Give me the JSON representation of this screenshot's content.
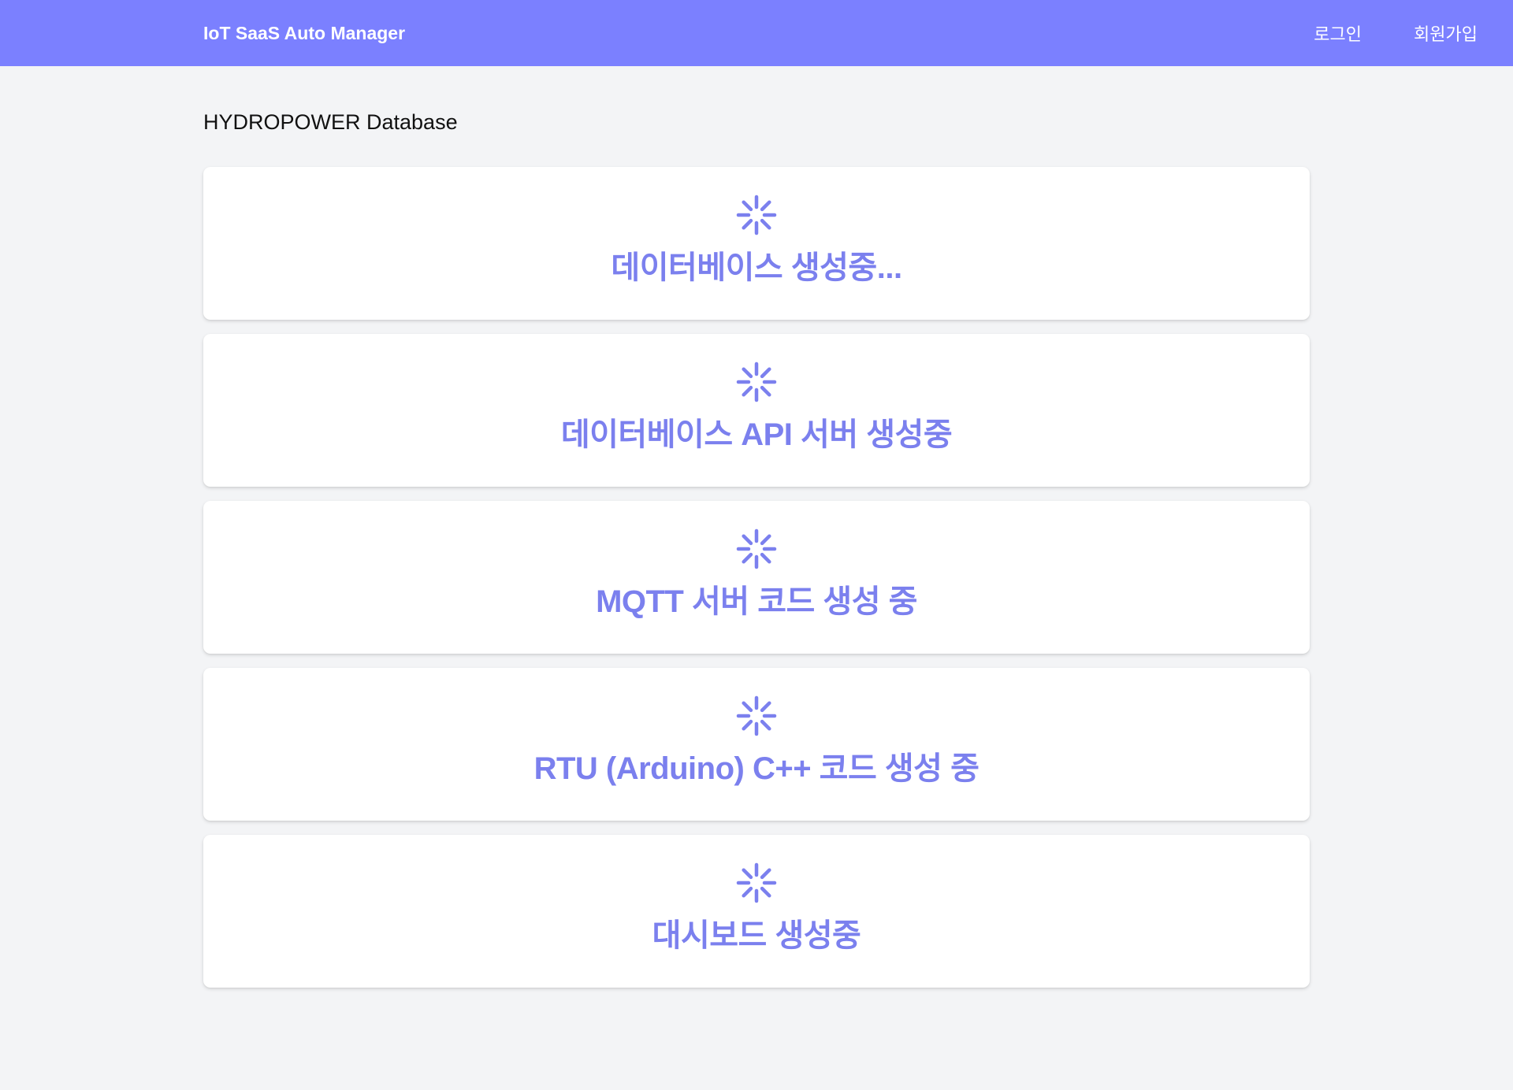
{
  "navbar": {
    "brand": "IoT SaaS Auto Manager",
    "links": [
      "로그인",
      "회원가입"
    ],
    "color": "#7b80ff"
  },
  "page": {
    "title": "HYDROPOWER Database"
  },
  "tasks": [
    {
      "label": "데이터베이스 생성중...",
      "icon": "loader-icon"
    },
    {
      "label": "데이터베이스 API 서버 생성중",
      "icon": "loader-icon"
    },
    {
      "label": "MQTT 서버 코드 생성 중",
      "icon": "loader-icon"
    },
    {
      "label": "RTU (Arduino) C++ 코드 생성 중",
      "icon": "loader-icon"
    },
    {
      "label": "대시보드 생성중",
      "icon": "loader-icon"
    }
  ],
  "accent": "#7b80ee"
}
